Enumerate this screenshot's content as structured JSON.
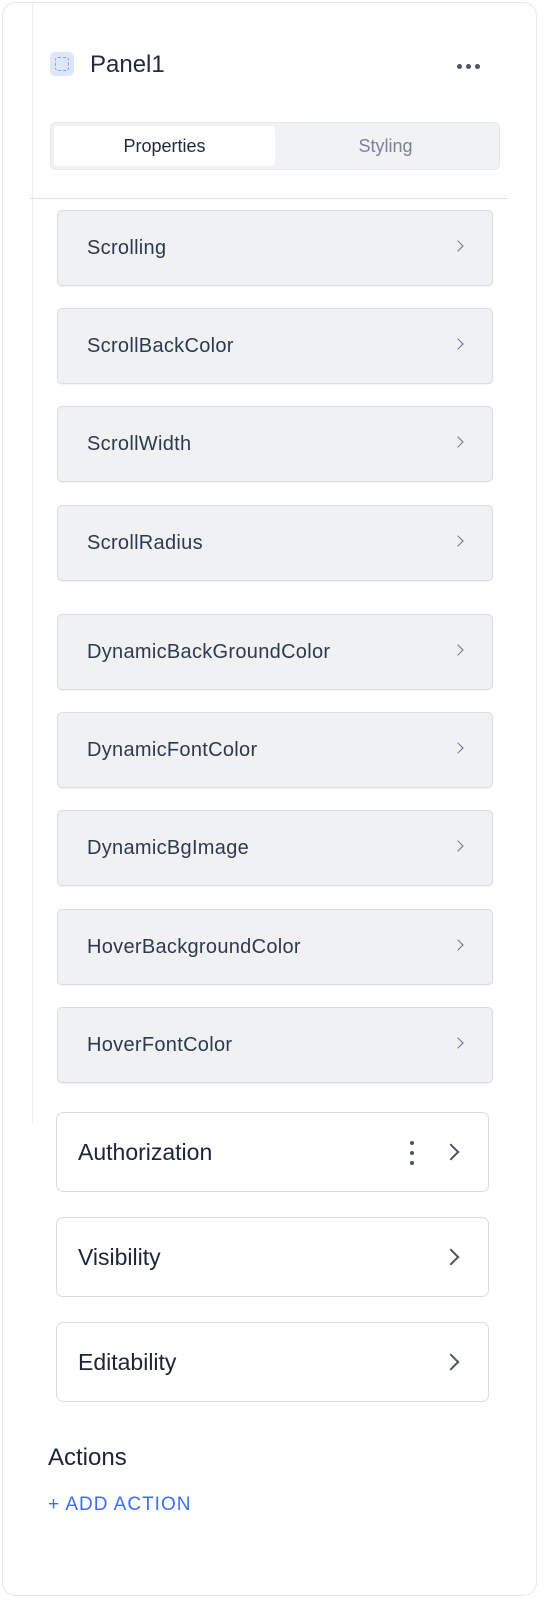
{
  "header": {
    "title": "Panel1",
    "panel_icon": "panel-icon",
    "more_icon": "more-horizontal-icon"
  },
  "tabs": [
    {
      "label": "Properties",
      "active": true
    },
    {
      "label": "Styling",
      "active": false
    }
  ],
  "properties": [
    {
      "label": "Scrolling"
    },
    {
      "label": "ScrollBackColor"
    },
    {
      "label": "ScrollWidth"
    },
    {
      "label": "ScrollRadius"
    },
    {
      "label": "DynamicBackGroundColor"
    },
    {
      "label": "DynamicFontColor"
    },
    {
      "label": "DynamicBgImage"
    },
    {
      "label": "HoverBackgroundColor"
    },
    {
      "label": "HoverFontColor"
    }
  ],
  "sections": [
    {
      "label": "Authorization"
    },
    {
      "label": "Visibility"
    },
    {
      "label": "Editability"
    }
  ],
  "actions": {
    "title": "Actions",
    "add_label": "+ ADD ACTION"
  },
  "colors": {
    "accent": "#3b6ef5",
    "item_bg": "#f0f1f3",
    "text": "#1f2a3c"
  }
}
